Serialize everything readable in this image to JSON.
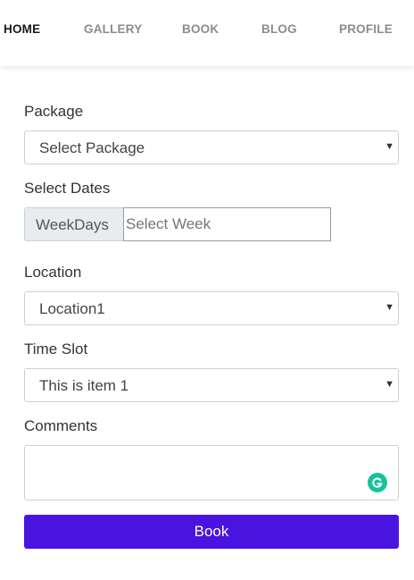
{
  "nav": {
    "items": [
      {
        "label": "HOME",
        "active": true
      },
      {
        "label": "GALLERY",
        "active": false
      },
      {
        "label": "BOOK",
        "active": false
      },
      {
        "label": "BLOG",
        "active": false
      },
      {
        "label": "PROFILE",
        "active": false
      }
    ]
  },
  "form": {
    "package": {
      "label": "Package",
      "value": "Select Package"
    },
    "dates": {
      "label": "Select Dates",
      "addon": "WeekDays",
      "placeholder": "Select Week",
      "value": ""
    },
    "location": {
      "label": "Location",
      "value": "Location1"
    },
    "time_slot": {
      "label": "Time Slot",
      "value": "This is item 1"
    },
    "comments": {
      "label": "Comments",
      "value": ""
    },
    "submit_label": "Book"
  },
  "icons": {
    "select_arrow": "caret-down-icon",
    "grammarly": "grammarly-icon"
  },
  "colors": {
    "primary_button": "#4a14e0",
    "grammarly": "#15c39a",
    "addon_bg": "#e9ecef"
  }
}
